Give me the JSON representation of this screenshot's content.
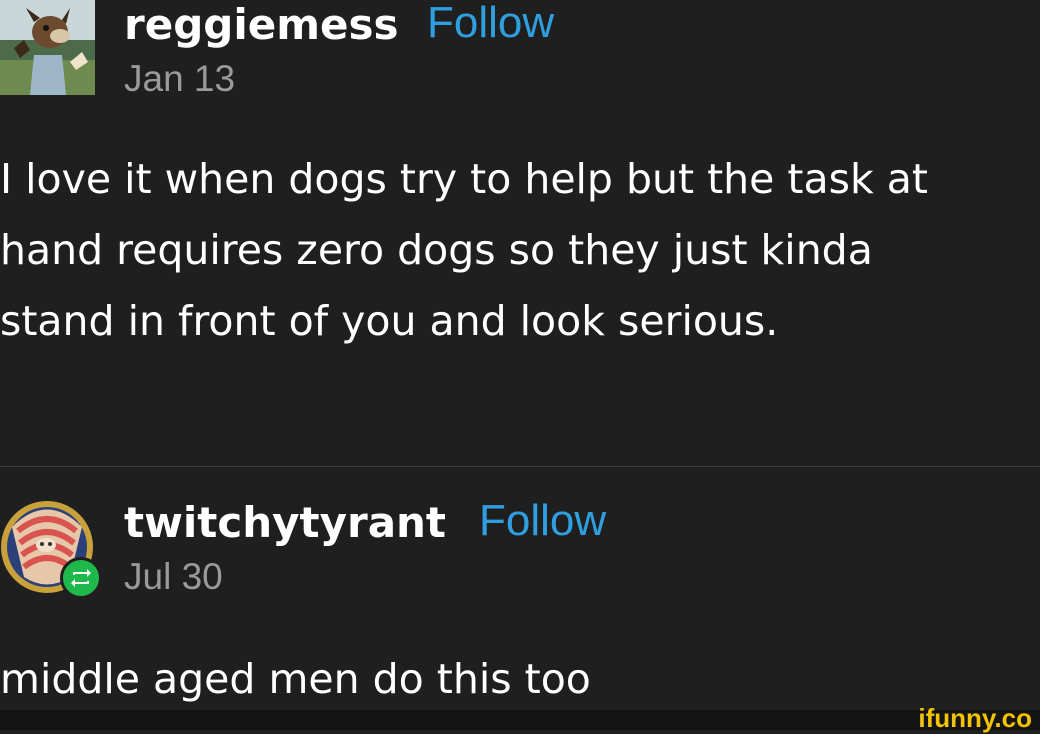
{
  "posts": [
    {
      "username": "reggiemess",
      "follow_label": "Follow",
      "date": "Jan 13",
      "avatar": "cartoon-dog-avatar",
      "body_lines": [
        "I love it when dogs try to help but the task at",
        "hand requires zero dogs so they just kinda",
        "stand in front of you and look serious."
      ]
    },
    {
      "username": "twitchytyrant",
      "follow_label": "Follow",
      "date": "Jul 30",
      "avatar": "cartoon-character-avatar",
      "reblog_badge": "reblog-icon",
      "body_lines": [
        "middle aged men do this too"
      ]
    }
  ],
  "watermark": "ifunny.co",
  "colors": {
    "background": "#1f1f1f",
    "follow": "#2f9fe0",
    "date": "#9a9a9a",
    "reblog_badge": "#1fb84a",
    "watermark": "#f2c300"
  }
}
